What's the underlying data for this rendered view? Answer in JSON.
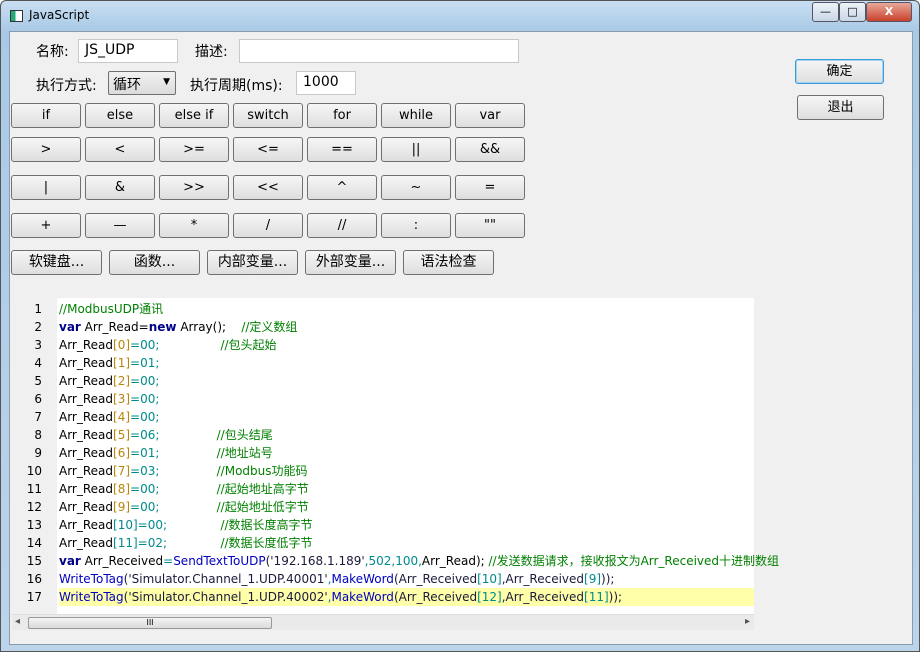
{
  "window": {
    "title": "JavaScript",
    "minimize": "—",
    "maximize": "□",
    "close": "X"
  },
  "form": {
    "name_label": "名称:",
    "name_value": "JS_UDP",
    "desc_label": "描述:",
    "desc_value": "",
    "mode_label": "执行方式:",
    "mode_value": "循环",
    "period_label": "执行周期(ms):",
    "period_value": "1000"
  },
  "actions": {
    "ok": "确定",
    "exit": "退出"
  },
  "keys": [
    [
      "if",
      "else",
      "else if",
      "switch",
      "for",
      "while",
      "var"
    ],
    [
      ">",
      "<",
      ">=",
      "<=",
      "==",
      "||",
      "&&"
    ],
    [
      "|",
      "&",
      ">>",
      "<<",
      "^",
      "~",
      "="
    ],
    [
      "+",
      "—",
      "*",
      "/",
      "//",
      ":",
      "\"\""
    ]
  ],
  "tools": [
    "软键盘...",
    "函数...",
    "内部变量...",
    "外部变量...",
    "语法检查"
  ],
  "code": [
    [
      [
        "//ModbusUDP通讯",
        "c"
      ]
    ],
    [
      [
        "var",
        "k"
      ],
      [
        " Arr_Read=",
        "i"
      ],
      [
        "new",
        "k"
      ],
      [
        " Array();    ",
        "i"
      ],
      [
        "//定义数组",
        "c"
      ]
    ],
    [
      [
        "Arr_Read",
        "i"
      ],
      [
        "[0]",
        "b"
      ],
      [
        "=00;",
        "n"
      ],
      [
        "                ",
        "i"
      ],
      [
        "//包头起始",
        "c"
      ]
    ],
    [
      [
        "Arr_Read",
        "i"
      ],
      [
        "[1]",
        "b"
      ],
      [
        "=01;",
        "n"
      ]
    ],
    [
      [
        "Arr_Read",
        "i"
      ],
      [
        "[2]",
        "b"
      ],
      [
        "=00;",
        "n"
      ]
    ],
    [
      [
        "Arr_Read",
        "i"
      ],
      [
        "[3]",
        "b"
      ],
      [
        "=00;",
        "n"
      ]
    ],
    [
      [
        "Arr_Read",
        "i"
      ],
      [
        "[4]",
        "b"
      ],
      [
        "=00;",
        "n"
      ]
    ],
    [
      [
        "Arr_Read",
        "i"
      ],
      [
        "[5]",
        "b"
      ],
      [
        "=06;",
        "n"
      ],
      [
        "               ",
        "i"
      ],
      [
        "//包头结尾",
        "c"
      ]
    ],
    [
      [
        "Arr_Read",
        "i"
      ],
      [
        "[6]",
        "b"
      ],
      [
        "=01;",
        "n"
      ],
      [
        "               ",
        "i"
      ],
      [
        "//地址站号",
        "c"
      ]
    ],
    [
      [
        "Arr_Read",
        "i"
      ],
      [
        "[7]",
        "b"
      ],
      [
        "=03;",
        "n"
      ],
      [
        "               ",
        "i"
      ],
      [
        "//Modbus功能码",
        "c"
      ]
    ],
    [
      [
        "Arr_Read",
        "i"
      ],
      [
        "[8]",
        "b"
      ],
      [
        "=00;",
        "n"
      ],
      [
        "               ",
        "i"
      ],
      [
        "//起始地址高字节",
        "c"
      ]
    ],
    [
      [
        "Arr_Read",
        "i"
      ],
      [
        "[9]",
        "b"
      ],
      [
        "=00;",
        "n"
      ],
      [
        "               ",
        "i"
      ],
      [
        "//起始地址低字节",
        "c"
      ]
    ],
    [
      [
        "Arr_Read",
        "i"
      ],
      [
        "[10]",
        "n"
      ],
      [
        "=00;",
        "n"
      ],
      [
        "              ",
        "i"
      ],
      [
        "//数据长度高字节",
        "c"
      ]
    ],
    [
      [
        "Arr_Read",
        "i"
      ],
      [
        "[11]",
        "n"
      ],
      [
        "=02;",
        "n"
      ],
      [
        "              ",
        "i"
      ],
      [
        "//数据长度低字节",
        "c"
      ]
    ],
    [
      [
        "var",
        "k"
      ],
      [
        " Arr_Received",
        "i"
      ],
      [
        "=",
        "n"
      ],
      [
        "SendTextToUDP",
        "f"
      ],
      [
        "('192.168.1.189'",
        "s"
      ],
      [
        ",502,100,",
        "n"
      ],
      [
        "Arr_Read); ",
        "i"
      ],
      [
        "//发送数据请求，接收报文为Arr_Received十进制数组",
        "c"
      ]
    ],
    [
      [
        "WriteToTag",
        "f"
      ],
      [
        "('Simulator.Channel_1.UDP.40001'",
        "s"
      ],
      [
        ",",
        "n"
      ],
      [
        "MakeWord",
        "f"
      ],
      [
        "(Arr_Received",
        "s"
      ],
      [
        "[10]",
        "n"
      ],
      [
        ",Arr_Received",
        "s"
      ],
      [
        "[9]",
        "n"
      ],
      [
        "));",
        "s"
      ]
    ],
    [
      [
        "WriteToTag",
        "f"
      ],
      [
        "('Simulator.Channel_1.UDP.40002'",
        "s"
      ],
      [
        ",",
        "n"
      ],
      [
        "MakeWord",
        "f"
      ],
      [
        "(Arr_Received",
        "s"
      ],
      [
        "[12]",
        "n"
      ],
      [
        ",Arr_Received",
        "s"
      ],
      [
        "[11]",
        "n"
      ],
      [
        "));",
        "s"
      ]
    ]
  ],
  "highlighted_line": 17,
  "scrollbar": {
    "thumb_grip": "III",
    "left_arrow": "◂",
    "right_arrow": "▸"
  }
}
